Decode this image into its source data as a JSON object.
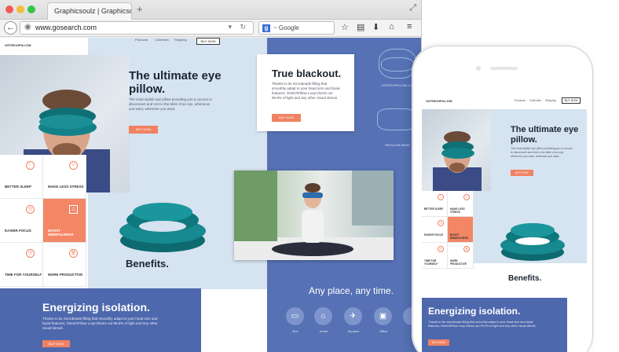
{
  "browser": {
    "tab_title": "Graphicsoulz | Graphicsoulz",
    "new_tab_label": "+",
    "url": "www.gosearch.com",
    "search_engine": "Google",
    "search_prefix": "8 ~ Google"
  },
  "page": {
    "nav": {
      "logo": "OSTRICHPILLOW",
      "links": [
        "Products",
        "Collection",
        "Shipping"
      ],
      "buy_label": "BUY NOW"
    },
    "hero": {
      "title": "The ultimate eye pillow.",
      "text": "The most stylish eye pillow providing you a cocoon to disconnect and rest in the blink of an eye, whenever you want, wherever you want.",
      "button": "BUY NOW"
    },
    "blackout": {
      "title": "True blackout.",
      "text": "Thanks to its microbeads filling that smoothly adapt to your head size and facial features, OstrichPillow Loop blocks out 99.9% of light and any other visual stimuli.",
      "button": "BUY NOW"
    },
    "products": [
      "OSTRICHPILLOW LOOP",
      "REGULAR MASK"
    ],
    "benefits": {
      "title": "Benefits.",
      "items": [
        "BETTER SLEEP",
        "MAKE LESS STRESS",
        "EASIER FOCUS",
        "BOOST MINDFULNESS",
        "TIME FOR YOURSELF",
        "MORE PRODUCTIVE"
      ]
    },
    "energizing": {
      "title": "Energizing isolation.",
      "text": "Thanks to its microbeads filling that smoothly adapt to your head size and facial features, OstrichPillow Loop blocks out 99.9% of light and any other visual stimuli.",
      "button": "BUY NOW"
    },
    "anyplace": {
      "title": "Any place, any time.",
      "items": [
        "Bus",
        "Home",
        "Airplane",
        "Office"
      ]
    }
  },
  "colors": {
    "accent": "#f08262",
    "brand_blue": "#5671b4",
    "light_blue": "#d6e3f0",
    "dark_text": "#1c2430"
  }
}
